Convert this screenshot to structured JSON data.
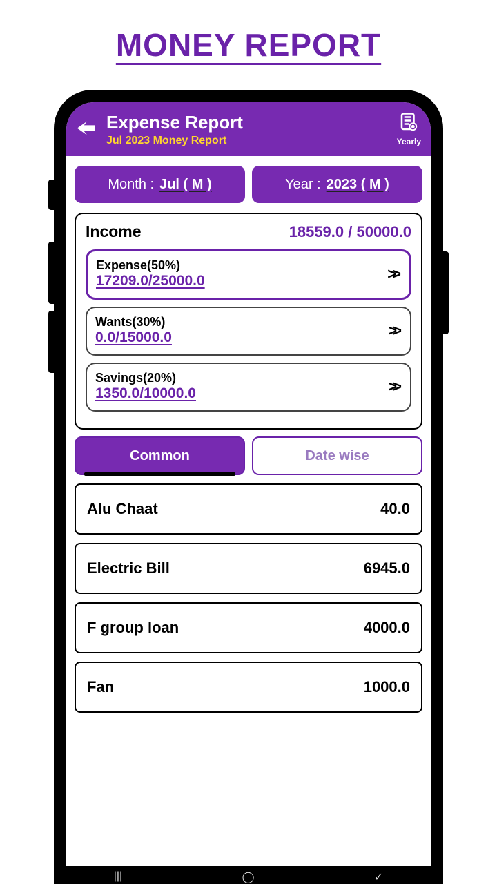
{
  "page": {
    "title": "MONEY REPORT"
  },
  "header": {
    "title": "Expense Report",
    "subtitle": "Jul 2023 Money Report",
    "yearly_label": "Yearly"
  },
  "selectors": {
    "month_label": "Month :",
    "month_value": "Jul ( M )",
    "year_label": "Year :",
    "year_value": "2023 ( M )"
  },
  "income": {
    "label": "Income",
    "value": "18559.0 / 50000.0",
    "categories": [
      {
        "title": "Expense(50%)",
        "value": "17209.0/25000.0",
        "active": true
      },
      {
        "title": "Wants(30%)",
        "value": "0.0/15000.0",
        "active": false
      },
      {
        "title": "Savings(20%)",
        "value": "1350.0/10000.0",
        "active": false
      }
    ]
  },
  "tabs": {
    "common": "Common",
    "datewise": "Date wise",
    "active": "common"
  },
  "expenses": [
    {
      "name": "Alu Chaat",
      "amount": "40.0"
    },
    {
      "name": "Electric Bill",
      "amount": "6945.0"
    },
    {
      "name": "F group loan",
      "amount": "4000.0"
    },
    {
      "name": "Fan",
      "amount": "1000.0"
    }
  ],
  "colors": {
    "primary": "#772ab1",
    "accent": "#ffd62e"
  }
}
